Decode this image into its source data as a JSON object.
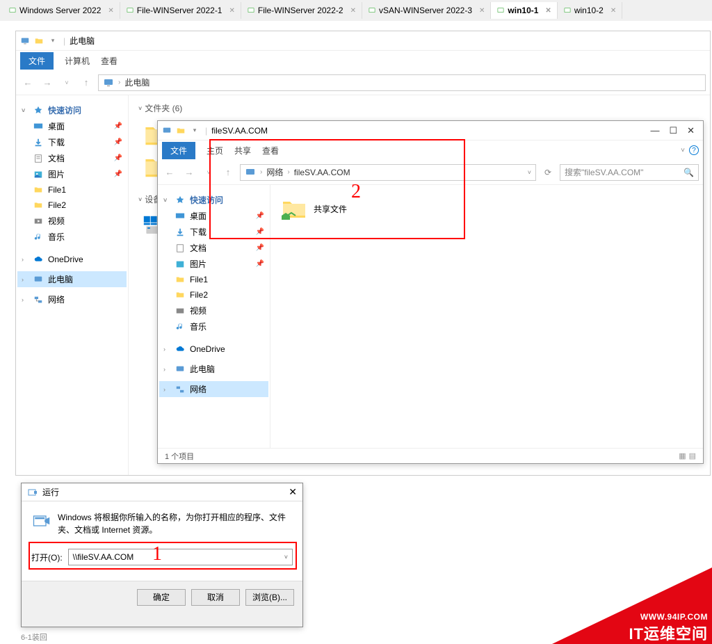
{
  "topTabs": [
    {
      "label": "Windows Server 2022",
      "active": false
    },
    {
      "label": "File-WINServer 2022-1",
      "active": false
    },
    {
      "label": "File-WINServer 2022-2",
      "active": false
    },
    {
      "label": "vSAN-WINServer 2022-3",
      "active": false
    },
    {
      "label": "win10-1",
      "active": true
    },
    {
      "label": "win10-2",
      "active": false
    }
  ],
  "backWindow": {
    "title": "此电脑",
    "fileTab": "文件",
    "ribbon": [
      "计算机",
      "查看"
    ],
    "breadcrumb": [
      "此电脑"
    ],
    "sidebar": {
      "quickAccess": "快速访问",
      "items": [
        {
          "label": "桌面",
          "icon": "desktop",
          "pinned": true
        },
        {
          "label": "下载",
          "icon": "download",
          "pinned": true
        },
        {
          "label": "文档",
          "icon": "document",
          "pinned": true
        },
        {
          "label": "图片",
          "icon": "picture",
          "pinned": true
        },
        {
          "label": "File1",
          "icon": "folder",
          "pinned": false
        },
        {
          "label": "File2",
          "icon": "folder",
          "pinned": false
        },
        {
          "label": "视频",
          "icon": "video",
          "pinned": false
        },
        {
          "label": "音乐",
          "icon": "music",
          "pinned": false
        }
      ],
      "onedrive": "OneDrive",
      "thispc": "此电脑",
      "network": "网络"
    },
    "content": {
      "folderSection": "文件夹 (6)",
      "deviceSection": "设备"
    }
  },
  "frontWindow": {
    "title": "fileSV.AA.COM",
    "fileTab": "文件",
    "ribbon": [
      "主页",
      "共享",
      "查看"
    ],
    "breadcrumb": [
      "网络",
      "fileSV.AA.COM"
    ],
    "searchPlaceholder": "搜索\"fileSV.AA.COM\"",
    "sidebar": {
      "quickAccess": "快速访问",
      "items": [
        {
          "label": "桌面",
          "icon": "desktop",
          "pinned": true
        },
        {
          "label": "下载",
          "icon": "download",
          "pinned": true
        },
        {
          "label": "文档",
          "icon": "document",
          "pinned": true
        },
        {
          "label": "图片",
          "icon": "picture",
          "pinned": true
        },
        {
          "label": "File1",
          "icon": "folder",
          "pinned": false
        },
        {
          "label": "File2",
          "icon": "folder",
          "pinned": false
        },
        {
          "label": "视频",
          "icon": "video",
          "pinned": false
        },
        {
          "label": "音乐",
          "icon": "music",
          "pinned": false
        }
      ],
      "onedrive": "OneDrive",
      "thispc": "此电脑",
      "network": "网络"
    },
    "content": {
      "sharedFolder": "共享文件"
    },
    "statusbar": "1 个项目",
    "annotation2": "2"
  },
  "runDialog": {
    "title": "运行",
    "description": "Windows 将根据你所输入的名称，为你打开相应的程序、文件夹、文档或 Internet 资源。",
    "openLabel": "打开(O):",
    "inputValue": "\\\\fileSV.AA.COM",
    "buttons": {
      "ok": "确定",
      "cancel": "取消",
      "browse": "浏览(B)..."
    },
    "annotation1": "1"
  },
  "footerLabel": "6-1装回",
  "watermark": {
    "line1": "WWW.94IP.COM",
    "line2": "IT运维空间"
  }
}
